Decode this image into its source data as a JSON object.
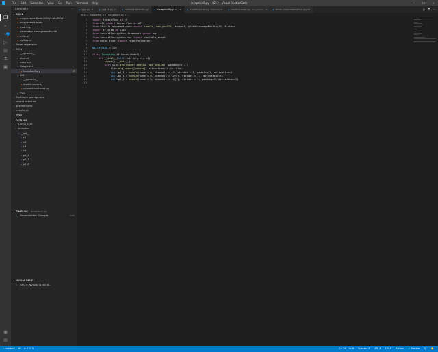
{
  "window": {
    "title": "inception5.py - d2l-2 - Visual Studio Code",
    "menu": [
      "File",
      "Edit",
      "Selection",
      "View",
      "Go",
      "Run",
      "Terminal",
      "Help"
    ],
    "controls": [
      "—",
      "☐",
      "✕"
    ]
  },
  "activity": {
    "icons": [
      "explorer-icon",
      "search-icon",
      "source-control-icon",
      "run-debug-icon",
      "extensions-icon",
      "testing-icon",
      "remote-icon",
      "account-icon",
      "settings-icon"
    ],
    "scm_badge": "6"
  },
  "sidebar": {
    "header": "EXPLORER",
    "header_actions": "···",
    "root": "D2L-2",
    "tree": [
      {
        "label": "mnpyeverne.Debs-2010/1-xh-20001",
        "depth": 1,
        "kind": "file"
      },
      {
        "label": "mnpyeverne.make",
        "depth": 1,
        "kind": "file"
      },
      {
        "label": "matrix.py",
        "depth": 1,
        "kind": "file"
      },
      {
        "label": "parameter managementipynb",
        "depth": 1,
        "kind": "file"
      },
      {
        "label": "x-file.py",
        "depth": 1,
        "kind": "file"
      },
      {
        "label": "xy.files.py",
        "depth": 1,
        "kind": "file"
      },
      {
        "label": "linear regression",
        "depth": 0,
        "kind": "folder"
      },
      {
        "label": "MCN",
        "depth": 0,
        "kind": "folder"
      },
      {
        "label": "__pycache__",
        "depth": 1,
        "kind": "folder"
      },
      {
        "label": "alexnet",
        "depth": 1,
        "kind": "folder"
      },
      {
        "label": "exercises",
        "depth": 1,
        "kind": "folder"
      },
      {
        "label": "GoogleNet",
        "depth": 1,
        "kind": "folder"
      },
      {
        "label": "inception5.py",
        "depth": 2,
        "kind": "file",
        "selected": true,
        "mod": "M"
      },
      {
        "label": "NiN",
        "depth": 1,
        "kind": "folder"
      },
      {
        "label": "__pycache__",
        "depth": 2,
        "kind": "folder"
      },
      {
        "label": "modelrunner.py",
        "depth": 2,
        "kind": "file"
      },
      {
        "label": "networkinnetwork.py",
        "depth": 2,
        "kind": "file"
      },
      {
        "label": "VGG",
        "depth": 1,
        "kind": "folder"
      },
      {
        "label": "Multilayer perceptrons",
        "depth": 0,
        "kind": "folder"
      },
      {
        "label": "object detection",
        "depth": 0,
        "kind": "folder"
      },
      {
        "label": "preliminaries",
        "depth": 0,
        "kind": "folder"
      },
      {
        "label": "results_dir",
        "depth": 0,
        "kind": "folder"
      },
      {
        "label": "RNN",
        "depth": 0,
        "kind": "folder"
      }
    ],
    "outline_title": "OUTLINE",
    "outline": [
      {
        "label": "BATCH_SIZE",
        "depth": 1
      },
      {
        "label": "Inception",
        "depth": 1
      },
      {
        "label": "__init__",
        "depth": 2
      },
      {
        "label": "c1",
        "depth": 3
      },
      {
        "label": "c2",
        "depth": 3
      },
      {
        "label": "c3",
        "depth": 3
      },
      {
        "label": "c4",
        "depth": 3
      },
      {
        "label": "p1_1",
        "depth": 3
      },
      {
        "label": "p2_1",
        "depth": 3
      },
      {
        "label": "p2_2",
        "depth": 3
      }
    ],
    "timeline_title": "TIMELINE",
    "timeline_file": "inception5.py",
    "timeline_entry": "Uncommitted Changes",
    "timeline_time": "now",
    "nvidia_title": "NVIDIA GPUS",
    "nvidia_entry": "GPU 0: NVIDIA T1000 8..."
  },
  "tabs": [
    {
      "label": "vgg.py",
      "hint": "M",
      "active": false
    },
    {
      "label": "vgg16.py",
      "hint": "M",
      "active": false
    },
    {
      "label": "networknetwork.py",
      "hint": "",
      "active": false
    },
    {
      "label": "inception5.py",
      "hint": "M",
      "active": true
    },
    {
      "label": "modelrunner.py",
      "hint": "NiN/trNIN M",
      "active": false
    },
    {
      "label": "modelrunner.py",
      "hint": "GoogleNet/.. M",
      "active": false
    },
    {
      "label": "keras implementation.ipynb",
      "hint": "",
      "active": false
    }
  ],
  "tab_actions": [
    "▷",
    "⧉",
    "···"
  ],
  "breadcrumb": "MCN > GoogleNet > ⬡ inception5.py > ...",
  "code": [
    "import tensorflow as tf",
    "from d2l import tensorflow as d2l",
    "from tfutils.argumentscope import conv2d, max_pool2d, dropout, globalAveragePooling2D, flatten",
    "import tf_slim as slim",
    "from tensorflow.python.framework import ops",
    "from tensorflow.python.ops import variable_scope",
    "from keras_tuner import HyperParameters",
    "",
    "BATCH_SIZE = 128",
    "",
    "class Inception(tf.keras.Model):",
    "    def __init__(self, c1, c2, c3, c4):",
    "        super().__init__()",
    "        with slim.arg_scope([conv2d, max_pool2d], padding='SAME'), \\",
    "            slim.arg_scope([conv2d], activation=tf.nn.relu):",
    "            self.p1_1 = conv2d(name = 'path_1', channels = c1, strides = 1, padding='same', activation='relu')",
    "            self.p2_1 = conv2d(name = 'path_2_1', channels = c2[0], strides = 1,  activation='relu')",
    "            self.p2_2 = conv2d(name = 'path_2_2', channels = c2[1], strides = 3, padding='same', activation='relu')",
    ""
  ],
  "status": {
    "branch": "master*",
    "sync": "⟳",
    "problems": "⊗ 0  ⚠ 0",
    "position": "Ln 19, Col 9",
    "spaces": "Spaces: 4",
    "encoding": "UTF-8",
    "eol": "CRLF",
    "language": "Python",
    "prettier": "✓ Prettier",
    "feedback": "☺",
    "bell": "🔔"
  }
}
